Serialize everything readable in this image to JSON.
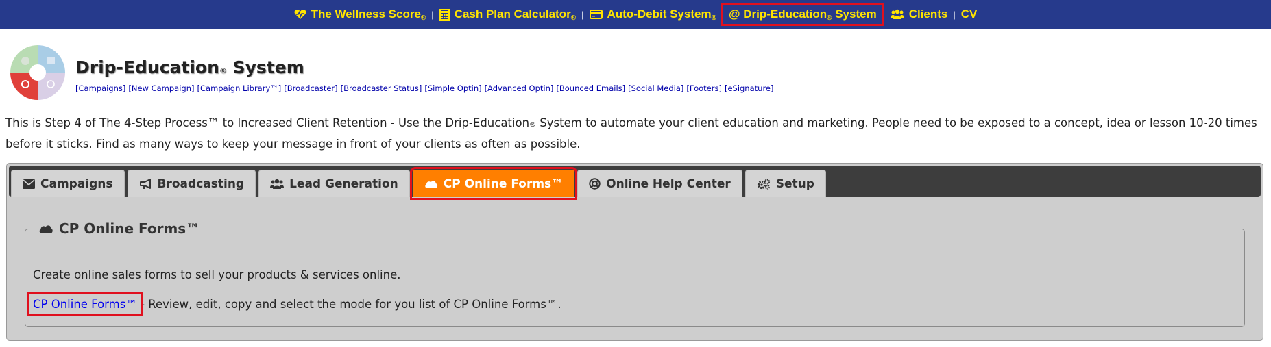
{
  "topnav": {
    "items": [
      {
        "label": "The Wellness Score",
        "reg": "®",
        "icon": "heartbeat-icon"
      },
      {
        "label": "Cash Plan Calculator",
        "reg": "®",
        "icon": "calculator-icon"
      },
      {
        "label": "Auto-Debit System",
        "reg": "®",
        "icon": "credit-card-icon"
      },
      {
        "label": "@ Drip-Education",
        "reg": "®",
        "suffix": "System"
      },
      {
        "label": "Clients",
        "icon": "users-icon"
      },
      {
        "label": "CV"
      }
    ],
    "separator": "|",
    "colors": {
      "background": "#263a8c",
      "link": "#ffe400",
      "highlight": "#e0101e"
    }
  },
  "header": {
    "title": "Drip-Education",
    "title_reg": "®",
    "title_suffix": "System",
    "logo_icon": "puzzle-wheel-logo",
    "subnav": [
      "[Campaigns]",
      "[New Campaign]",
      "[Campaign Library™]",
      "[Broadcaster]",
      "[Broadcaster Status]",
      "[Simple Optin]",
      "[Advanced Optin]",
      "[Bounced Emails]",
      "[Social Media]",
      "[Footers]",
      "[eSignature]"
    ]
  },
  "intro": {
    "part1": "This is Step 4 of The 4-Step Process™ to Increased Client Retention - Use the Drip-Education",
    "reg": "®",
    "part2": "System to automate your client education and marketing. People need to be exposed to a concept, idea or lesson 10-20 times before it sticks. Find as many ways to keep your message in front of your clients as often as possible."
  },
  "tabs": [
    {
      "label": "Campaigns",
      "icon": "envelope-icon"
    },
    {
      "label": "Broadcasting",
      "icon": "bullhorn-icon"
    },
    {
      "label": "Lead Generation",
      "icon": "users-icon"
    },
    {
      "label": "CP Online Forms™",
      "icon": "cloud-icon",
      "active": true
    },
    {
      "label": "Online Help Center",
      "icon": "life-ring-icon"
    },
    {
      "label": "Setup",
      "icon": "cogs-icon"
    }
  ],
  "group": {
    "legend": "CP Online Forms™",
    "legend_icon": "cloud-icon",
    "description": "Create online sales forms to sell your products & services online.",
    "link_label": "CP Online Forms™",
    "link_text": " - Review, edit, copy and select the mode for you list of CP Online Forms™."
  },
  "colors": {
    "active_tab": "#ff7f00",
    "tabbar": "#3d3d3d",
    "panel": "#cecece",
    "link": "#0000ee"
  }
}
